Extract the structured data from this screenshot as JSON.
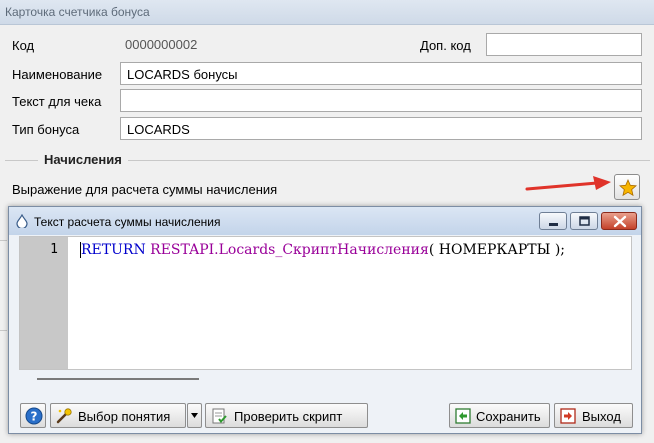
{
  "parent_window": {
    "title": "Карточка счетчика бонуса",
    "code_label": "Код",
    "code_value": "0000000002",
    "extra_code_label": "Доп. код",
    "extra_code_value": "",
    "name_label": "Наименование",
    "name_value": "LOCARDS бонусы",
    "receipt_text_label": "Текст для чека",
    "receipt_text_value": "",
    "bonus_type_label": "Тип бонуса",
    "bonus_type_value": "LOCARDS",
    "accruals_group_title": "Начисления",
    "expression_label": "Выражение для расчета суммы начисления",
    "expression_button_icon": "star-icon"
  },
  "dialog": {
    "title": "Текст расчета суммы начисления",
    "editor": {
      "line_number": "1",
      "code_keyword": "RETURN",
      "code_function": "RESTAPI.Locards_СкриптНачисления",
      "code_rest": "( НОМЕРКАРТЫ );"
    },
    "buttons": {
      "help_icon": "help-icon",
      "choose_concept": "Выбор понятия",
      "check_script": "Проверить скрипт",
      "save": "Сохранить",
      "exit": "Выход"
    }
  },
  "colors": {
    "keyword": "#0000cc",
    "function": "#990099",
    "annotation_arrow": "#e0332a"
  }
}
